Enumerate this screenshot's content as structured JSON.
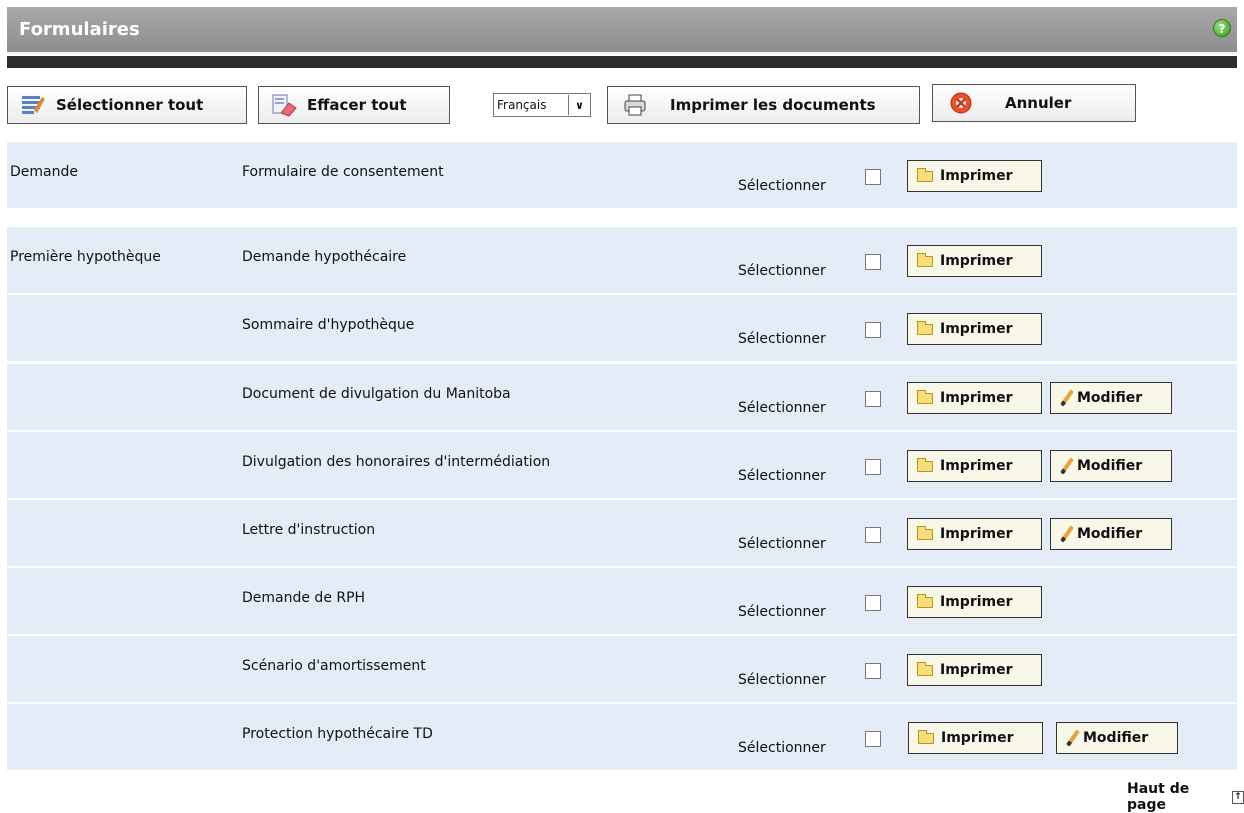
{
  "header": {
    "title": "Formulaires",
    "help_icon": "help-icon"
  },
  "toolbar": {
    "select_all": "Sélectionner tout",
    "clear_all": "Effacer tout",
    "language": "Français",
    "print_docs": "Imprimer les documents",
    "cancel": "Annuler"
  },
  "common": {
    "select_label": "Sélectionner",
    "print_label": "Imprimer",
    "edit_label": "Modifier"
  },
  "rows": [
    {
      "section": "Demande",
      "form": "Formulaire de consentement",
      "editable": false
    },
    {
      "section": "Première hypothèque",
      "form": "Demande hypothécaire",
      "editable": false
    },
    {
      "section": "",
      "form": "Sommaire d'hypothèque",
      "editable": false
    },
    {
      "section": "",
      "form": "Document de divulgation du Manitoba",
      "editable": true
    },
    {
      "section": "",
      "form": "Divulgation des honoraires d'intermédiation",
      "editable": true
    },
    {
      "section": "",
      "form": "Lettre d'instruction",
      "editable": true
    },
    {
      "section": "",
      "form": "Demande de RPH",
      "editable": false
    },
    {
      "section": "",
      "form": "Scénario d'amortissement",
      "editable": false
    },
    {
      "section": "",
      "form": "Protection hypothécaire TD",
      "editable": true
    }
  ],
  "footer": {
    "top_link": "Haut de page"
  }
}
